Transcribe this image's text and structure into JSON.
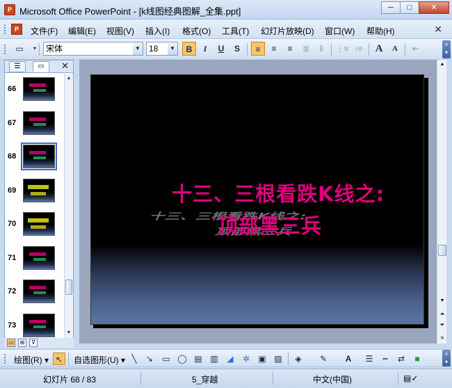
{
  "window": {
    "title": "Microsoft Office PowerPoint - [k线图经典图解_全集.ppt]",
    "min_label": "─",
    "max_label": "□",
    "close_label": "✕"
  },
  "menu": {
    "items": [
      "文件(F)",
      "编辑(E)",
      "视图(V)",
      "插入(I)",
      "格式(O)",
      "工具(T)",
      "幻灯片放映(D)",
      "窗口(W)",
      "帮助(H)"
    ],
    "close": "✕"
  },
  "toolbar": {
    "font_name": "宋体",
    "font_size": "18",
    "bold": "B",
    "italic": "I",
    "underline": "U",
    "shadow": "S",
    "grow_font": "A",
    "shrink_font": "A"
  },
  "outline": {
    "tab_outline_icon": "outline-tab-icon",
    "tab_slides_icon": "slides-tab-icon",
    "close": "✕",
    "slides": [
      {
        "num": "66",
        "style": "color"
      },
      {
        "num": "67",
        "style": "color"
      },
      {
        "num": "68",
        "style": "color",
        "selected": true
      },
      {
        "num": "69",
        "style": "yellow"
      },
      {
        "num": "70",
        "style": "yellow"
      },
      {
        "num": "71",
        "style": "color"
      },
      {
        "num": "72",
        "style": "color"
      },
      {
        "num": "73",
        "style": "color"
      }
    ]
  },
  "slide": {
    "line1": "十三、三根看跌K线之:",
    "line2": "顶部黑三兵",
    "reflection1": "十三、三根看跌K线之:",
    "reflection2": "顶部黑三兵"
  },
  "drawing_toolbar": {
    "draw_label": "绘图(R)",
    "autoshapes_label": "自选图形(U)"
  },
  "status": {
    "slide_info": "幻灯片 68 / 83",
    "design": "5_穿越",
    "language": "中文(中国)"
  }
}
